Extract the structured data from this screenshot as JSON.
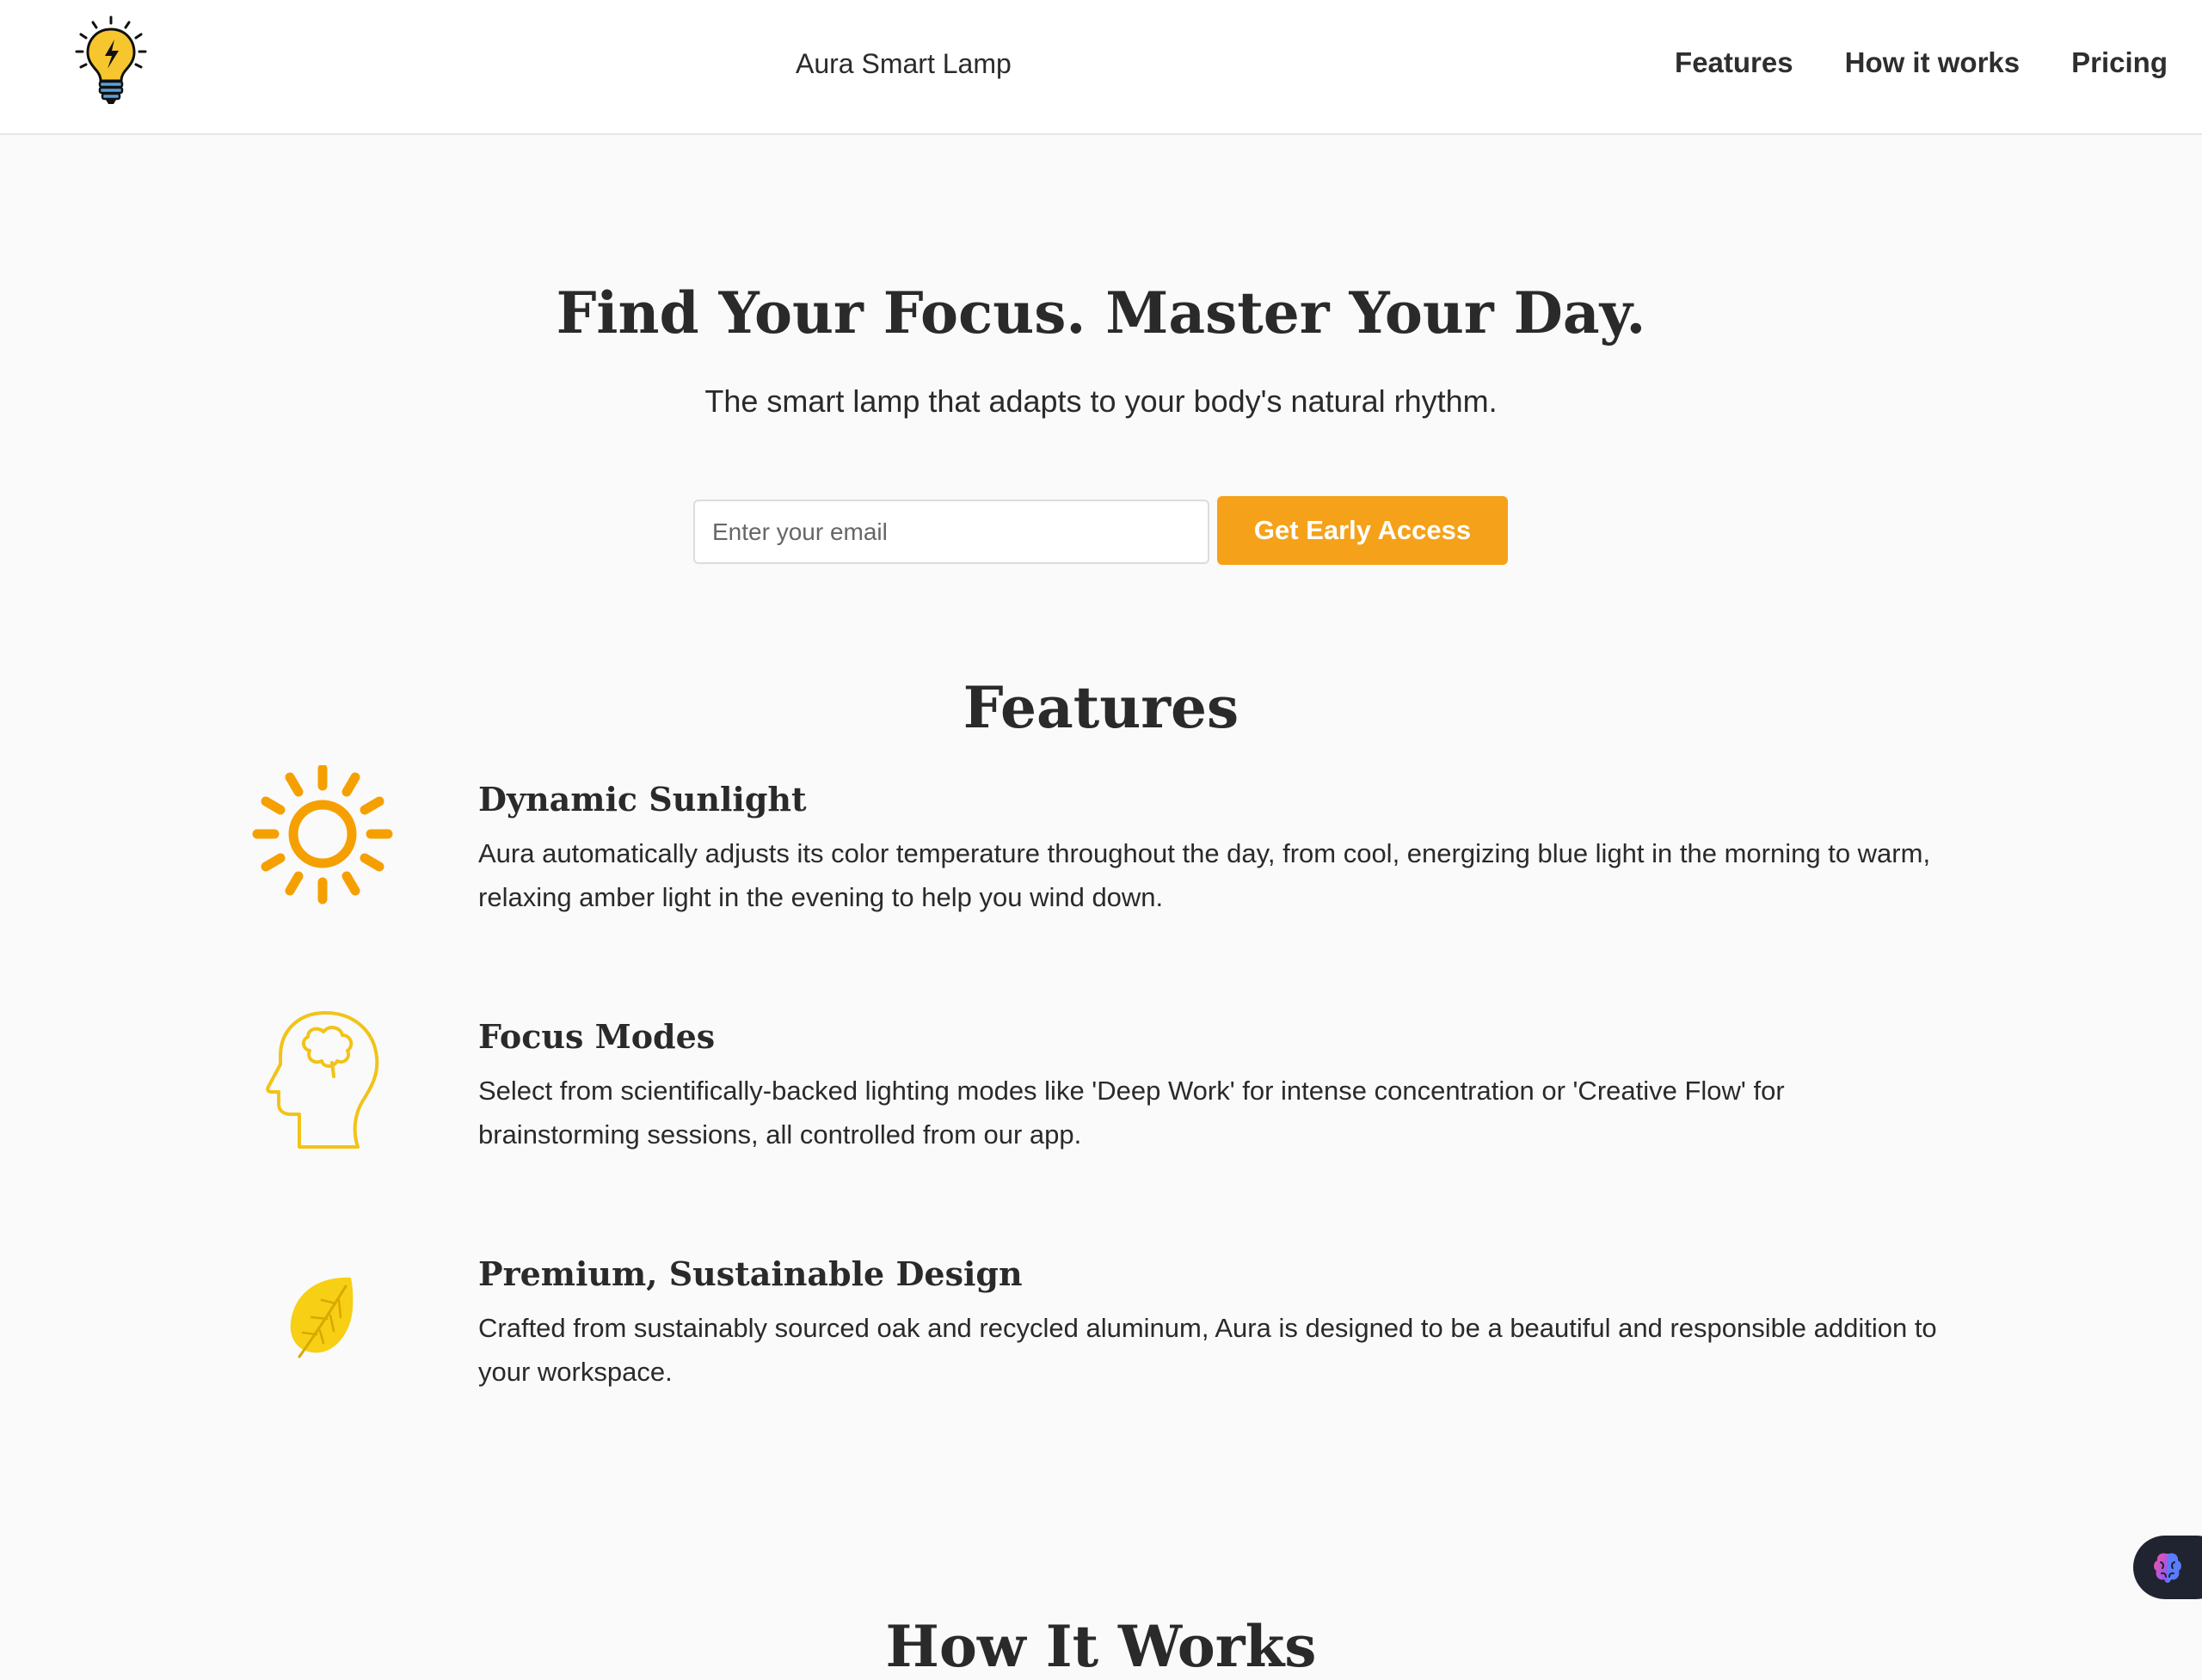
{
  "header": {
    "brand": "Aura Smart Lamp",
    "logo_icon": "lightbulb-icon",
    "nav": [
      {
        "label": "Features"
      },
      {
        "label": "How it works"
      },
      {
        "label": "Pricing"
      }
    ]
  },
  "hero": {
    "title": "Find Your Focus. Master Your Day.",
    "subtitle": "The smart lamp that adapts to your body's natural rhythm.",
    "email_placeholder": "Enter your email",
    "cta_label": "Get Early Access"
  },
  "features": {
    "title": "Features",
    "items": [
      {
        "icon": "sun-icon",
        "heading": "Dynamic Sunlight",
        "text": "Aura automatically adjusts its color temperature throughout the day, from cool, energizing blue light in the morning to warm, relaxing amber light in the evening to help you wind down."
      },
      {
        "icon": "head-brain-icon",
        "heading": "Focus Modes",
        "text": "Select from scientifically-backed lighting modes like 'Deep Work' for intense concentration or 'Creative Flow' for brainstorming sessions, all controlled from our app."
      },
      {
        "icon": "leaf-icon",
        "heading": "Premium, Sustainable Design",
        "text": "Crafted from sustainably sourced oak and recycled aluminum, Aura is designed to be a beautiful and responsible addition to your workspace."
      }
    ]
  },
  "how_it_works": {
    "title": "How It Works"
  },
  "widget": {
    "icon": "brain-icon"
  },
  "colors": {
    "accent": "#f5a21a",
    "sun": "#f5a000",
    "head_outline": "#f2c318",
    "leaf": "#f7cf14",
    "text": "#2a2a2a",
    "widget_bg": "#1f2430"
  }
}
